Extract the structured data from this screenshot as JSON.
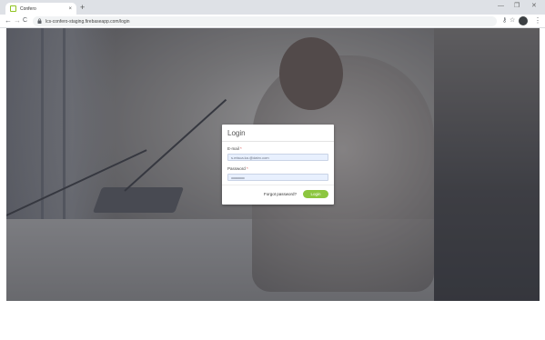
{
  "browser": {
    "tab_title": "Confero",
    "tab_close": "×",
    "new_tab": "+",
    "url": "lcs-confero-staging.firebaseapp.com/login",
    "win_min": "—",
    "win_max": "❐",
    "win_close": "✕",
    "icons": {
      "back": "←",
      "forward": "→",
      "reload": "C",
      "key": "⚷",
      "star": "☆",
      "menu": "⋮"
    }
  },
  "login": {
    "title": "Login",
    "email_label": "E-mail",
    "required_mark": "*",
    "email_value": "s.misca.ka.@datrx.com",
    "password_label": "Password",
    "password_value": "••••••••••••••••",
    "forgot_label": "Forgot password?",
    "submit_label": "Login"
  },
  "colors": {
    "accent": "#8cc63f",
    "required": "#d9534f",
    "autofill": "#e8f0fe"
  }
}
